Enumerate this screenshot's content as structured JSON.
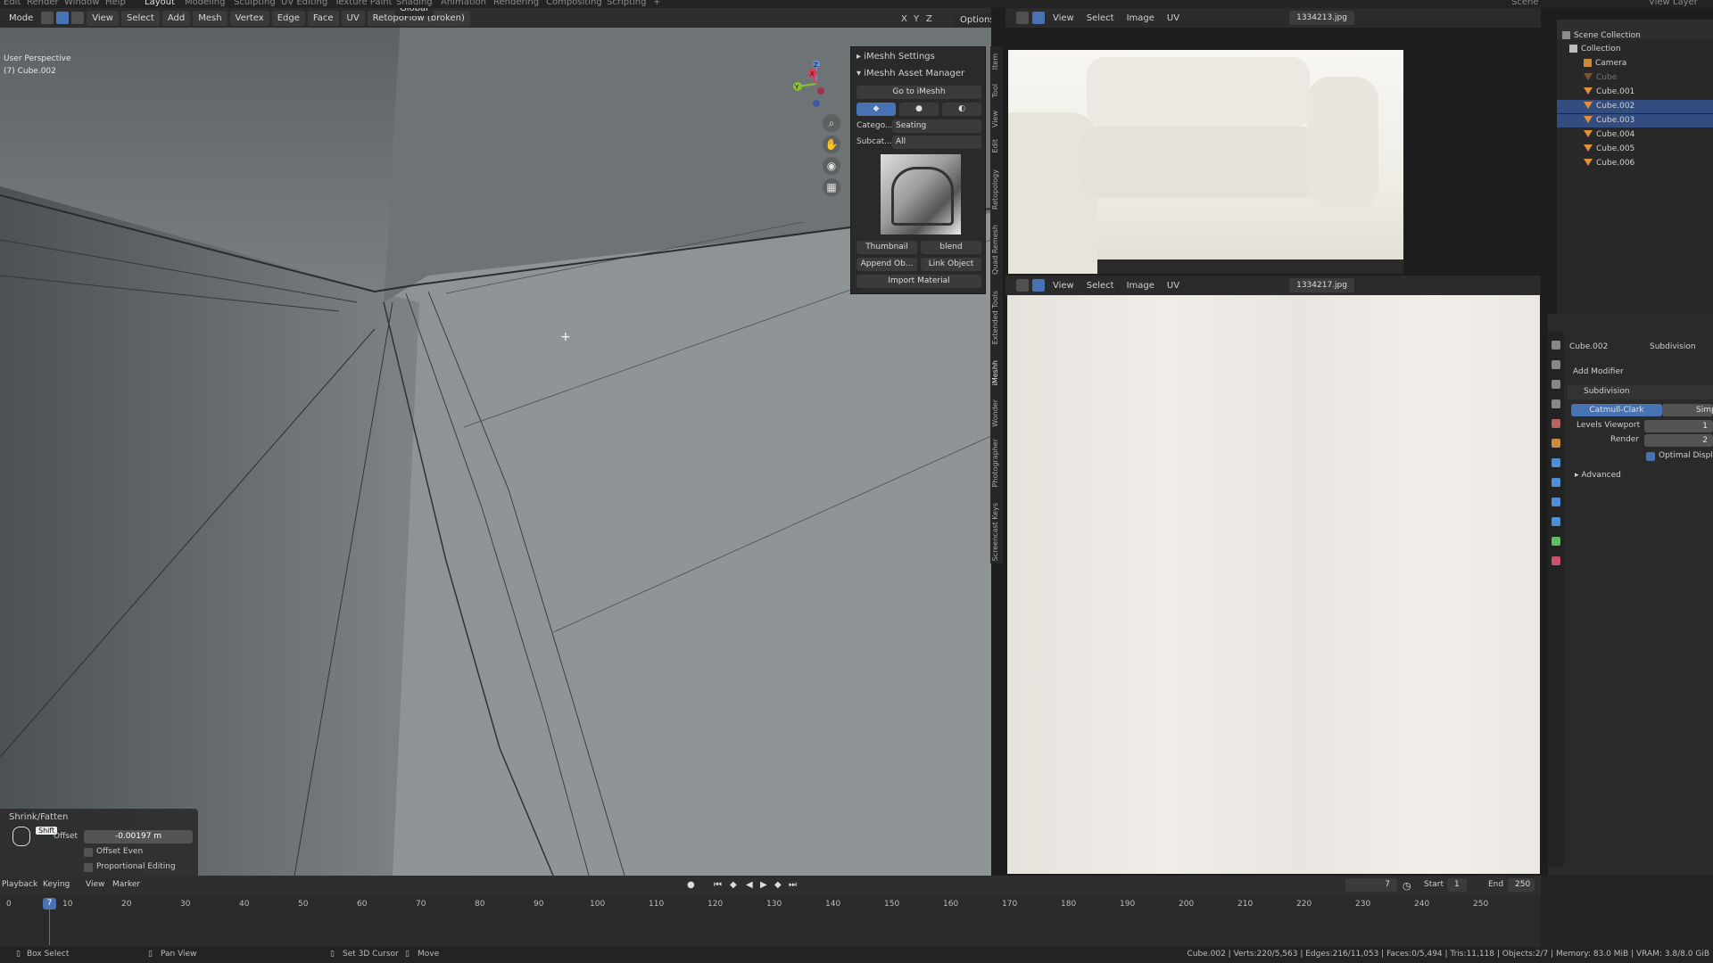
{
  "topbar": {
    "tabs": [
      "Edit",
      "Render",
      "Window",
      "Help",
      "Layout",
      "Modeling",
      "Sculpting",
      "UV Editing",
      "Texture Paint",
      "Shading",
      "Animation",
      "Rendering",
      "Compositing",
      "Scripting",
      "+"
    ],
    "active_tab": "Layout",
    "scene_label": "Scene",
    "view_layer_label": "View Layer"
  },
  "viewport": {
    "mode": "Mode",
    "menus": [
      "View",
      "Select",
      "Add",
      "Mesh",
      "Vertex",
      "Edge",
      "Face",
      "UV"
    ],
    "addon_menu": "RetopoFlow (broken)",
    "orientation": "Global",
    "axes": [
      "X",
      "Y",
      "Z"
    ],
    "options_label": "Options",
    "info_line1": "User Perspective",
    "info_line2": "(7) Cube.002",
    "gizmo": {
      "x_label": "X",
      "y_label": "Y",
      "z_label": "Z"
    },
    "accent": "#4772b3"
  },
  "npanel": {
    "settings_title": "iMeshh Settings",
    "asset_manager_title": "iMeshh Asset Manager",
    "go_button": "Go to iMeshh",
    "category_label": "Catego...",
    "category_value": "Seating",
    "subcategory_label": "Subcat...",
    "subcategory_value": "All",
    "thumbnail_button": "Thumbnail",
    "blend_button": "blend",
    "append_button": "Append Ob...",
    "link_button": "Link Object",
    "import_button": "Import Material",
    "tabs": [
      "Item",
      "Tool",
      "View",
      "Edit",
      "Retopology",
      "Quad Remesh",
      "Extended Tools",
      "iMeshh",
      "Wonder",
      "Photographer",
      "Screencast Keys"
    ]
  },
  "redo_panel": {
    "title": "Shrink/Fatten",
    "key_hint": "Shift",
    "offset_label": "Offset",
    "offset_value": "-0.00197 m",
    "offset_even_label": "Offset Even",
    "proportional_label": "Proportional Editing"
  },
  "image_editor_top": {
    "menus": [
      "View",
      "Select",
      "Image",
      "UV"
    ],
    "filename": "1334213.jpg"
  },
  "image_editor_bottom": {
    "menus": [
      "View",
      "Select",
      "Image",
      "UV"
    ],
    "filename": "1334217.jpg"
  },
  "outliner": {
    "title": "Scene Collection",
    "collection": "Collection",
    "items": [
      {
        "name": "Camera",
        "selected": false
      },
      {
        "name": "Cube",
        "selected": false
      },
      {
        "name": "Cube.001",
        "selected": false
      },
      {
        "name": "Cube.002",
        "selected": true
      },
      {
        "name": "Cube.003",
        "selected": true
      },
      {
        "name": "Cube.004",
        "selected": false
      },
      {
        "name": "Cube.005",
        "selected": false
      },
      {
        "name": "Cube.006",
        "selected": false
      }
    ]
  },
  "properties": {
    "object_name": "Cube.002",
    "modifier_tab": "Subdivision",
    "add_modifier": "Add Modifier",
    "modifier_name": "Subdivision",
    "catmull_clark": "Catmull-Clark",
    "simple": "Simple",
    "levels_viewport_label": "Levels Viewport",
    "levels_viewport_value": "1",
    "render_label": "Render",
    "render_value": "2",
    "optimal_display": "Optimal Display",
    "advanced": "Advanced"
  },
  "timeline": {
    "menus": [
      "Playback",
      "Keying",
      "View",
      "Marker"
    ],
    "current_frame": "7",
    "ticks": [
      "0",
      "10",
      "20",
      "30",
      "40",
      "50",
      "60",
      "70",
      "80",
      "90",
      "100",
      "110",
      "120",
      "130",
      "140",
      "150",
      "160",
      "170",
      "180",
      "190",
      "200",
      "210",
      "220",
      "230",
      "240",
      "250"
    ],
    "frame_field": "7",
    "start_label": "Start",
    "start_value": "1",
    "end_label": "End",
    "end_value": "250"
  },
  "status": {
    "box_select": "Box Select",
    "pan_view": "Pan View",
    "set_cursor": "Set 3D Cursor",
    "move": "Move",
    "stats": "Cube.002 | Verts:220/5,563 | Edges:216/11,053 | Faces:0/5,494 | Tris:11,118 | Objects:2/7 | Memory: 83.0 MiB | VRAM: 3.8/8.0 GiB"
  }
}
